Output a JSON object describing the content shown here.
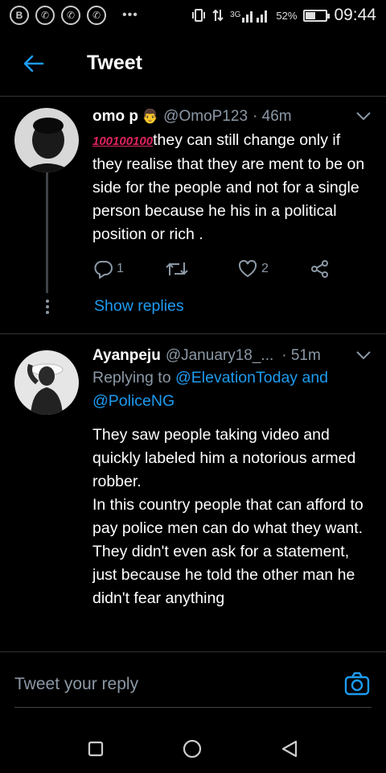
{
  "status_bar": {
    "left_icons": [
      "b-icon",
      "whatsapp-icon",
      "whatsapp-icon",
      "whatsapp-icon"
    ],
    "dots": "•••",
    "network": "3G",
    "battery": "52%",
    "battery_level": 0.52,
    "time": "09:44"
  },
  "header": {
    "title": "Tweet"
  },
  "tweets": [
    {
      "name": "omo p",
      "handle": "@OmoP123",
      "time": "· 46m",
      "emoji_text": "100100100",
      "text": "they can still change only if they realise that they are ment to be on side for the people and not for a single person because he his in a political position or rich .",
      "replies": "1",
      "retweets": "",
      "likes": "2",
      "show_replies": "Show replies"
    },
    {
      "name": "Ayanpeju",
      "handle": "@January18_...",
      "time": "· 51m",
      "replying_to_prefix": "Replying to",
      "mention_1": "@ElevationToday",
      "and": "and",
      "mention_2": "@PoliceNG",
      "text_lines": [
        "They saw people taking video and quickly labeled him a notorious armed robber.",
        "In this country people that can afford to pay police men can do what they want.",
        "They didn't even ask for a statement, just because he told the other man he didn't fear anything"
      ]
    }
  ],
  "reply_bar": {
    "placeholder": "Tweet your reply"
  },
  "colors": {
    "accent": "#1d9bf0",
    "background": "#000000",
    "muted": "#8b98a5"
  }
}
